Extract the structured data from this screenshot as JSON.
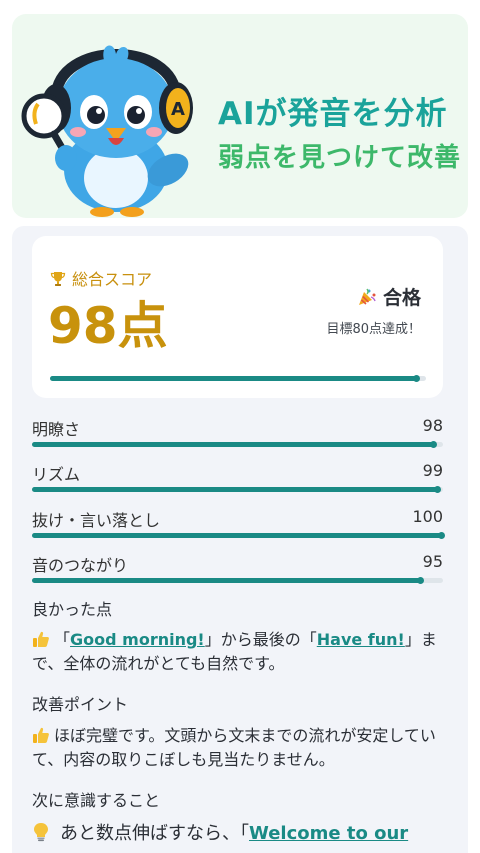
{
  "banner": {
    "title": "AIが発音を分析",
    "subtitle": "弱点を見つけて改善"
  },
  "score": {
    "label": "総合スコア",
    "value": "98点",
    "value_fraction": 0.98,
    "pass_label": "合格",
    "goal_text": "目標80点達成！"
  },
  "metrics": [
    {
      "name": "明瞭さ",
      "score": "98",
      "fraction": 0.98
    },
    {
      "name": "リズム",
      "score": "99",
      "fraction": 0.99
    },
    {
      "name": "抜け・言い落とし",
      "score": "100",
      "fraction": 1.0
    },
    {
      "name": "音のつながり",
      "score": "95",
      "fraction": 0.95
    }
  ],
  "good": {
    "title": "良かった点",
    "pre": "「",
    "phrase1": "Good morning!",
    "mid": "」から最後の「",
    "phrase2": "Have fun!",
    "post": "」まで、全体の流れがとても自然です。"
  },
  "improve": {
    "title": "改善ポイント",
    "text": "ほぼ完璧です。文頭から文末までの流れが安定していて、内容の取りこぼしも見当たりません。"
  },
  "next": {
    "title": "次に意識すること",
    "pre": "あと数点伸ばすなら、「",
    "phrase": "Welcome to our"
  },
  "icons": {
    "score": "trophy-icon",
    "pass": "party-popper-icon",
    "good": "thumbs-up-icon",
    "improve": "thumbs-up-icon",
    "next": "lightbulb-icon"
  },
  "colors": {
    "accent": "#1a8a85",
    "score": "#c8920c",
    "banner_title": "#1aa39a",
    "banner_sub": "#3db86a"
  }
}
